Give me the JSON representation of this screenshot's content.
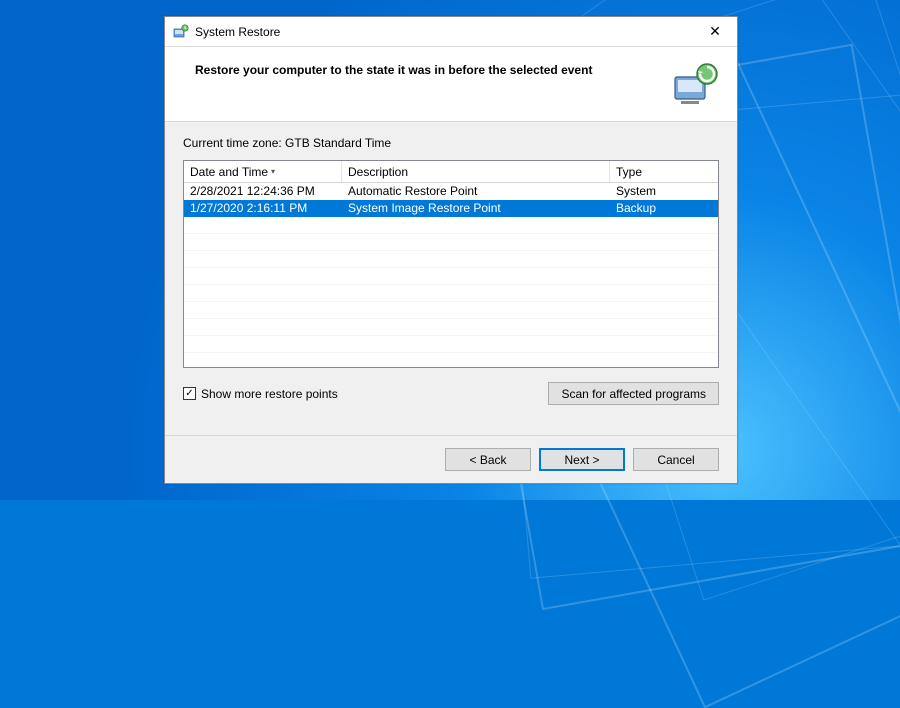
{
  "window": {
    "title": "System Restore"
  },
  "header": {
    "heading": "Restore your computer to the state it was in before the selected event"
  },
  "timezone_label": "Current time zone: GTB Standard Time",
  "grid": {
    "columns": {
      "date_time": "Date and Time",
      "description": "Description",
      "type": "Type"
    },
    "sort_indicator": "▾",
    "rows": [
      {
        "date_time": "2/28/2021 12:24:36 PM",
        "description": "Automatic Restore Point",
        "type": "System",
        "selected": false
      },
      {
        "date_time": "1/27/2020 2:16:11 PM",
        "description": "System Image Restore Point",
        "type": "Backup",
        "selected": true
      }
    ]
  },
  "checkbox": {
    "label": "Show more restore points",
    "checked": true
  },
  "buttons": {
    "scan": "Scan for affected programs",
    "back": "< Back",
    "next": "Next >",
    "cancel": "Cancel"
  }
}
